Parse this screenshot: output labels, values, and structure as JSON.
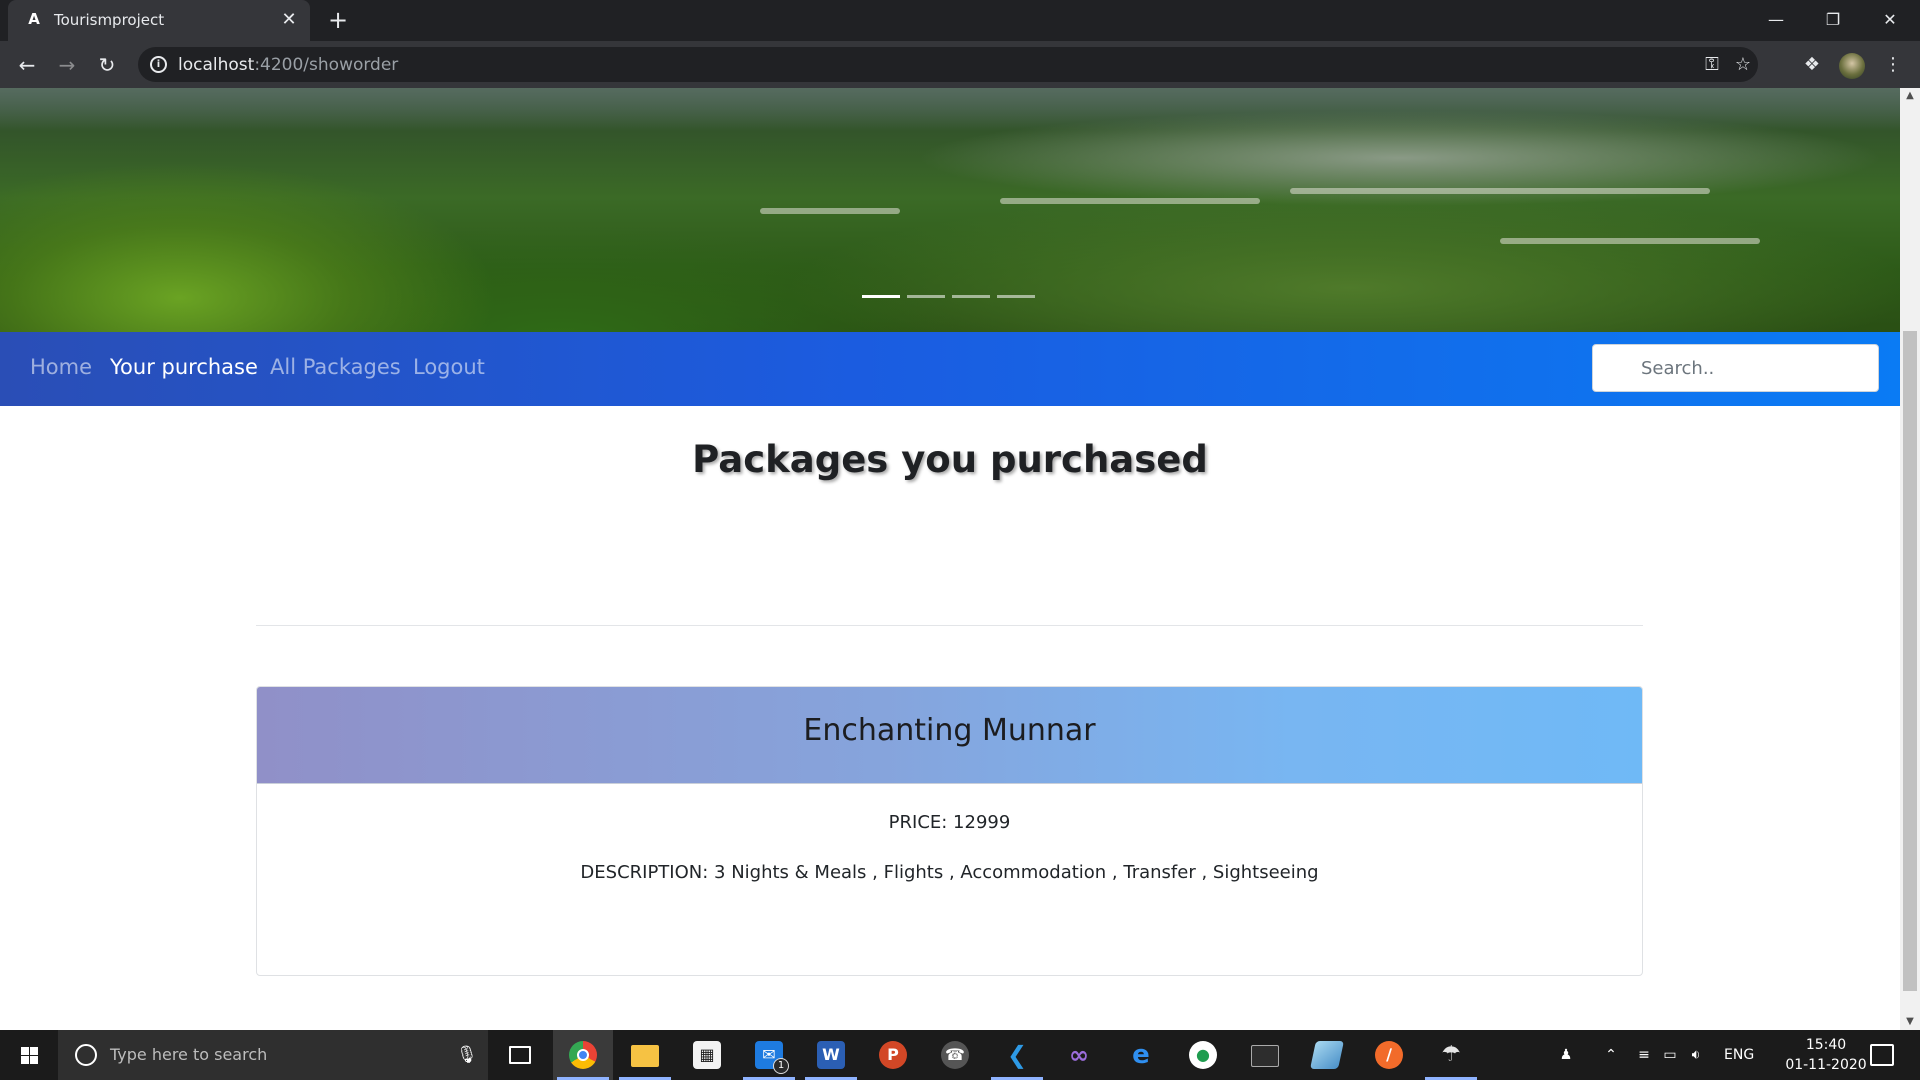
{
  "browser": {
    "tab_title": "Tourismproject",
    "tab_favicon": "A",
    "url_host": "localhost",
    "url_path": ":4200/showorder",
    "icons": [
      "back-icon",
      "forward-icon",
      "reload-icon",
      "info-icon",
      "key-icon",
      "star-icon",
      "puzzle-icon",
      "menu-dots-icon"
    ],
    "window_controls": [
      "minimize-icon",
      "restore-icon",
      "close-icon"
    ]
  },
  "carousel": {
    "indicator_count": 4,
    "active_index": 0
  },
  "navbar": {
    "links": [
      {
        "label": "Home",
        "active": false
      },
      {
        "label": "Your purchase",
        "active": true
      },
      {
        "label": "All Packages",
        "active": false
      },
      {
        "label": "Logout",
        "active": false
      }
    ],
    "search_placeholder": "Search.."
  },
  "main": {
    "heading": "Packages you purchased",
    "orders": [
      {
        "name": "Enchanting Munnar",
        "price_text": "PRICE: 12999",
        "description_text": "DESCRIPTION: 3 Nights & Meals , Flights , Accommodation , Transfer , Sightseeing"
      }
    ]
  },
  "taskbar": {
    "search_placeholder": "Type here to search",
    "apps": [
      {
        "name": "chrome",
        "active": true
      },
      {
        "name": "file-explorer",
        "active": false
      },
      {
        "name": "store",
        "active": false
      },
      {
        "name": "mail",
        "active": false,
        "badge": "1"
      },
      {
        "name": "word",
        "active": false
      },
      {
        "name": "powerpoint",
        "active": false
      },
      {
        "name": "whatsapp",
        "active": false
      },
      {
        "name": "vscode",
        "active": false
      },
      {
        "name": "visual-studio",
        "active": false
      },
      {
        "name": "edge",
        "active": false
      },
      {
        "name": "app-green",
        "active": false
      },
      {
        "name": "terminal",
        "active": false
      },
      {
        "name": "app-blue",
        "active": false
      },
      {
        "name": "app-orange",
        "active": false
      },
      {
        "name": "app-paint",
        "active": false
      }
    ],
    "language": "ENG",
    "time": "15:40",
    "date": "01-11-2020"
  }
}
